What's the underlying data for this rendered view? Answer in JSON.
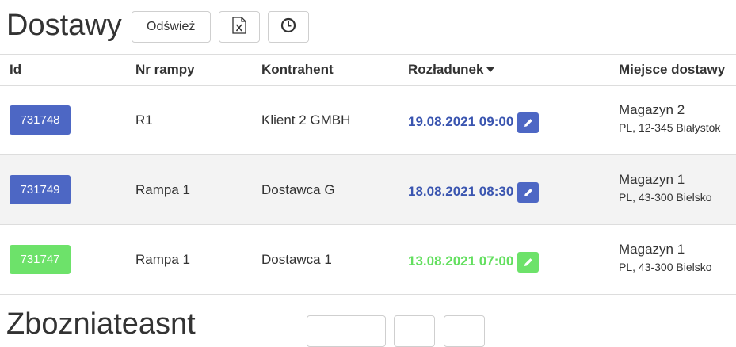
{
  "header": {
    "title": "Dostawy",
    "refresh_label": "Odśwież",
    "excel_icon": "excel-export-icon",
    "history_icon": "clock-icon"
  },
  "table": {
    "columns": [
      "Id",
      "Nr rampy",
      "Kontrahent",
      "Rozładunek",
      "Miejsce dostawy"
    ],
    "sorted_column": "Rozładunek",
    "sort_direction": "desc",
    "rows": [
      {
        "id": "731748",
        "rampa": "R1",
        "kontrahent": "Klient 2 GMBH",
        "rozladunek": "19.08.2021 09:00",
        "miejsce": "Magazyn 2",
        "adres": "PL, 12-345 Białystok",
        "status_color": "#4d67c4"
      },
      {
        "id": "731749",
        "rampa": "Rampa 1",
        "kontrahent": "Dostawca G",
        "rozladunek": "18.08.2021 08:30",
        "miejsce": "Magazyn 1",
        "adres": "PL, 43-300 Bielsko",
        "status_color": "#4d67c4"
      },
      {
        "id": "731747",
        "rampa": "Rampa 1",
        "kontrahent": "Dostawca 1",
        "rozladunek": "13.08.2021 07:00",
        "miejsce": "Magazyn 1",
        "adres": "PL, 43-300 Bielsko",
        "status_color": "#6de26a"
      }
    ]
  },
  "section2": {
    "title": "Zbozniateasnt"
  },
  "colors": {
    "blue": "#4d67c4",
    "green": "#6de26a"
  }
}
